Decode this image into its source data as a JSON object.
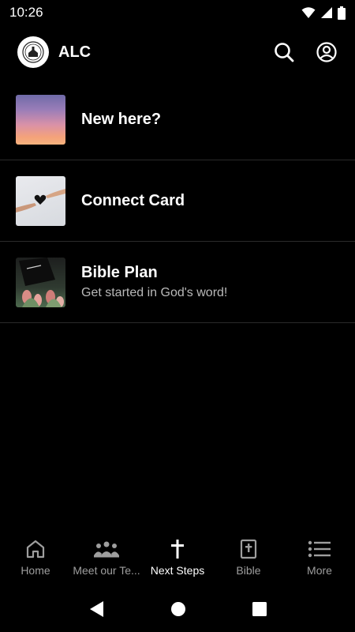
{
  "status": {
    "time": "10:26"
  },
  "header": {
    "title": "ALC"
  },
  "list": [
    {
      "title": "New here?",
      "subtitle": ""
    },
    {
      "title": "Connect Card",
      "subtitle": ""
    },
    {
      "title": "Bible Plan",
      "subtitle": "Get started in God's word!"
    }
  ],
  "bottom_nav": [
    {
      "label": "Home",
      "icon": "home-icon"
    },
    {
      "label": "Meet our Te...",
      "icon": "people-icon"
    },
    {
      "label": "Next Steps",
      "icon": "cross-icon",
      "active": true
    },
    {
      "label": "Bible",
      "icon": "bible-icon"
    },
    {
      "label": "More",
      "icon": "list-icon"
    }
  ],
  "colors": {
    "background": "#000000",
    "text": "#ffffff",
    "inactive": "#9e9e9e",
    "divider": "#2a2a2a"
  }
}
